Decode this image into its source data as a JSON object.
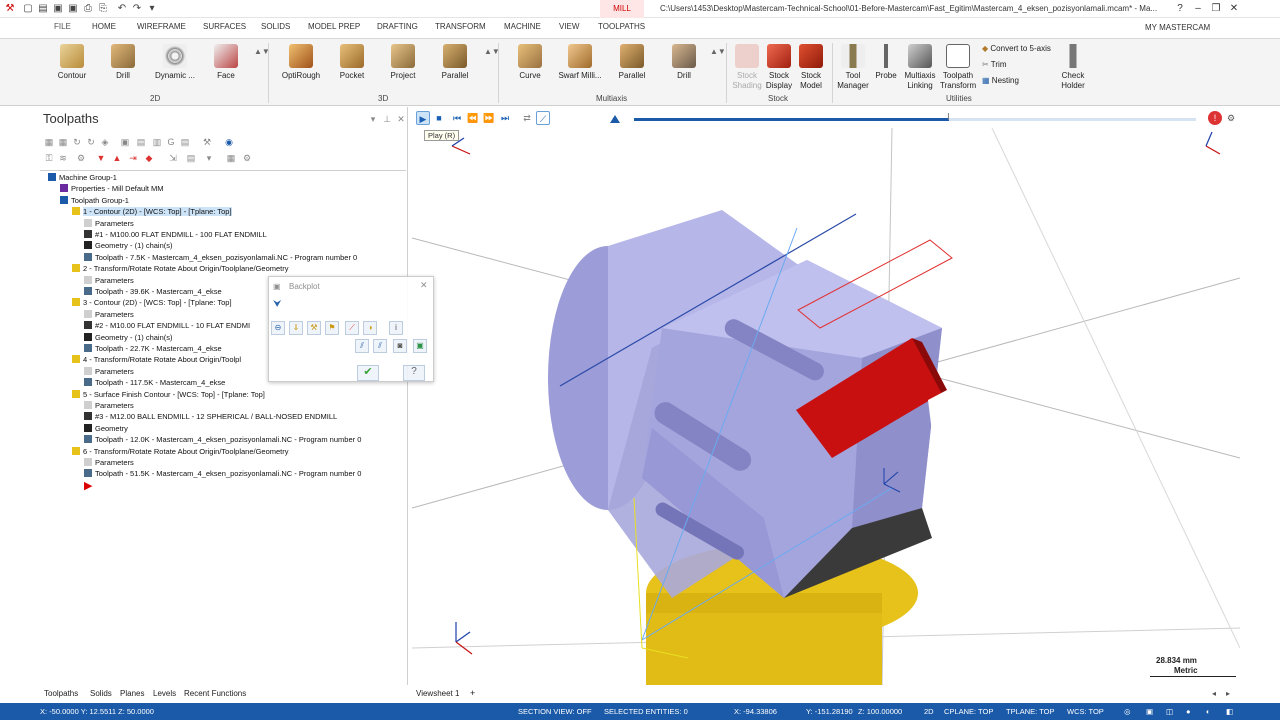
{
  "titlebar": {
    "mode_tab": "MILL",
    "path": "C:\\Users\\1453\\Desktop\\Mastercam-Technical-School\\01-Before-Mastercam\\Fast_Egitim\\Mastercam_4_eksen_pozisyonlamali.mcam* - Ma..."
  },
  "ribbon_tabs": [
    {
      "label": "FILE"
    },
    {
      "label": "HOME"
    },
    {
      "label": "WIREFRAME"
    },
    {
      "label": "SURFACES"
    },
    {
      "label": "SOLIDS"
    },
    {
      "label": "MODEL PREP"
    },
    {
      "label": "DRAFTING"
    },
    {
      "label": "TRANSFORM"
    },
    {
      "label": "MACHINE"
    },
    {
      "label": "VIEW"
    },
    {
      "label": "TOOLPATHS"
    }
  ],
  "my_mastercam": "MY MASTERCAM",
  "ribbon": {
    "groups": {
      "g2d": "2D",
      "g3d": "3D",
      "multiaxis": "Multiaxis",
      "stock": "Stock",
      "utilities": "Utilities"
    },
    "buttons_2d": [
      "Contour",
      "Drill",
      "Dynamic ...",
      "Face"
    ],
    "buttons_3d": [
      "OptiRough",
      "Pocket",
      "Project",
      "Parallel"
    ],
    "buttons_multiaxis": [
      "Curve",
      "Swarf Milli...",
      "Parallel",
      "Drill"
    ],
    "stock_shading": [
      "Stock",
      "Shading"
    ],
    "stock_display": [
      "Stock",
      "Display"
    ],
    "stock_model": [
      "Stock",
      "Model"
    ],
    "tool_manager": [
      "Tool",
      "Manager"
    ],
    "probe": "Probe",
    "multiaxis_linking": [
      "Multiaxis",
      "Linking"
    ],
    "toolpath_transform": [
      "Toolpath",
      "Transform"
    ],
    "convert": "Convert to 5-axis",
    "trim": "Trim",
    "nesting": "Nesting",
    "check_holder": [
      "Check",
      "Holder"
    ]
  },
  "panel": {
    "title": "Toolpaths",
    "tree": [
      {
        "level": 0,
        "text": "Machine Group-1",
        "icon": "machine-group-icon"
      },
      {
        "level": 1,
        "text": "Properties - Mill Default MM",
        "icon": "properties-icon"
      },
      {
        "level": 1,
        "text": "Toolpath Group-1",
        "icon": "toolpath-group-icon"
      },
      {
        "level": 2,
        "text": "1 - Contour (2D) - [WCS: Top] - [Tplane: Top]",
        "icon": "operation-folder-icon",
        "selected": true
      },
      {
        "level": 3,
        "text": "Parameters",
        "icon": "parameters-icon"
      },
      {
        "level": 3,
        "text": "#1 - M100.00 FLAT ENDMILL - 100 FLAT ENDMILL",
        "icon": "tool-icon"
      },
      {
        "level": 3,
        "text": "Geometry - (1) chain(s)",
        "icon": "geometry-icon"
      },
      {
        "level": 3,
        "text": "Toolpath - 7.5K - Mastercam_4_eksen_pozisyonlamali.NC - Program number 0",
        "icon": "toolpath-icon"
      },
      {
        "level": 2,
        "text": "2 - Transform/Rotate Rotate About Origin/Toolplane/Geometry",
        "icon": "operation-folder-icon"
      },
      {
        "level": 3,
        "text": "Parameters",
        "icon": "parameters-icon"
      },
      {
        "level": 3,
        "text": "Toolpath - 39.6K - Mastercam_4_ekse",
        "icon": "toolpath-icon"
      },
      {
        "level": 2,
        "text": "3 - Contour (2D) - [WCS: Top] - [Tplane: Top]",
        "icon": "operation-folder-icon"
      },
      {
        "level": 3,
        "text": "Parameters",
        "icon": "parameters-icon"
      },
      {
        "level": 3,
        "text": "#2 - M10.00 FLAT ENDMILL - 10 FLAT ENDMI",
        "icon": "tool-icon"
      },
      {
        "level": 3,
        "text": "Geometry - (1) chain(s)",
        "icon": "geometry-icon"
      },
      {
        "level": 3,
        "text": "Toolpath - 22.7K - Mastercam_4_ekse",
        "icon": "toolpath-icon"
      },
      {
        "level": 2,
        "text": "4 - Transform/Rotate Rotate About Origin/Toolpl",
        "icon": "operation-folder-icon"
      },
      {
        "level": 3,
        "text": "Parameters",
        "icon": "parameters-icon"
      },
      {
        "level": 3,
        "text": "Toolpath - 117.5K - Mastercam_4_ekse",
        "icon": "toolpath-icon"
      },
      {
        "level": 2,
        "text": "5 - Surface Finish Contour - [WCS: Top] - [Tplane: Top]",
        "icon": "operation-folder-icon"
      },
      {
        "level": 3,
        "text": "Parameters",
        "icon": "parameters-icon"
      },
      {
        "level": 3,
        "text": "#3 - M12.00 BALL ENDMILL - 12 SPHERICAL / BALL-NOSED ENDMILL",
        "icon": "tool-icon"
      },
      {
        "level": 3,
        "text": "Geometry",
        "icon": "geometry-icon"
      },
      {
        "level": 3,
        "text": "Toolpath - 12.0K - Mastercam_4_eksen_pozisyonlamali.NC - Program number 0",
        "icon": "toolpath-icon"
      },
      {
        "level": 2,
        "text": "6 - Transform/Rotate Rotate About Origin/Toolplane/Geometry",
        "icon": "operation-folder-icon"
      },
      {
        "level": 3,
        "text": "Parameters",
        "icon": "parameters-icon"
      },
      {
        "level": 3,
        "text": "Toolpath - 51.5K - Mastercam_4_eksen_pozisyonlamali.NC - Program number 0",
        "icon": "toolpath-icon"
      }
    ],
    "bottom_tabs": [
      "Toolpaths",
      "Solids",
      "Planes",
      "Levels",
      "Recent Functions"
    ]
  },
  "backplot": {
    "title": "Backplot"
  },
  "viewport": {
    "tooltip": "Play (R)",
    "sheet_tab": "Viewsheet 1",
    "add_sheet": "+",
    "scale_value": "28.834 mm",
    "scale_unit": "Metric",
    "progress": 0.56
  },
  "status": {
    "coords_left": "X: -50.0000   Y: 12.5511   Z: 50.0000",
    "section_view": "SECTION VIEW: OFF",
    "selected": "SELECTED ENTITIES: 0",
    "x": "X: -94.33806",
    "y": "Y: -151.28190",
    "z": "Z: 100.00000",
    "mode": "2D",
    "cplane": "CPLANE: TOP",
    "tplane": "TPLANE: TOP",
    "wcs": "WCS: TOP"
  },
  "colors": {
    "accent": "#1b5aa8",
    "part": "#a9a9df",
    "red_stock": "#c81010",
    "yellow_fixture": "#e6c21a",
    "selection": "#cde3f7"
  }
}
